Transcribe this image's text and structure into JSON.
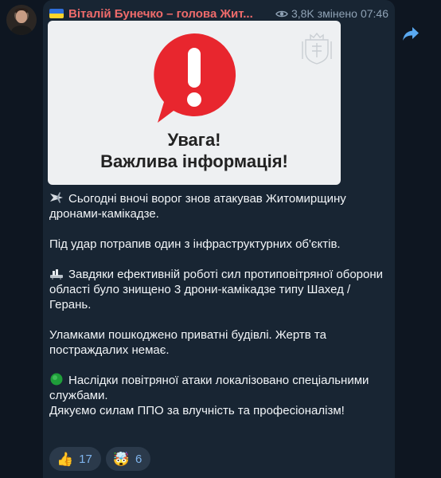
{
  "header": {
    "sender_name": "Віталій Бунечко – голова Жит...",
    "views": "3,8K",
    "edited_label": "змінено",
    "time": "07:46"
  },
  "card": {
    "title_line1": "Увага!",
    "title_line2": "Важлива інформація!"
  },
  "message": {
    "p1": "Сьогодні вночі ворог знов атакував Житомирщину дронами-камікадзе.",
    "p2": "Під удар потрапив один з інфраструктурних об'єктів.",
    "p3": "Завдяки ефективній роботі сил протиповітряної оборони області було знищено 3 дрони-камікадзе типу Шахед /Герань.",
    "p4": "Уламками пошкоджено приватні будівлі. Жертв та постраждалих немає.",
    "p5": "Наслідки повітряної атаки локалізовано спеціальними службами.",
    "p6": "Дякуємо силам ППО за влучність та професіоналізм!"
  },
  "reactions": [
    {
      "emoji": "👍",
      "count": "17"
    },
    {
      "emoji": "🤯",
      "count": "6"
    }
  ],
  "icons": {
    "eye": "eye-icon",
    "forward": "share-forward-icon",
    "flag": "ukraine-flag-icon"
  },
  "colors": {
    "background": "#0e1621",
    "bubble": "#182533",
    "sender": "#ef6b6b",
    "meta": "#8fa2b5",
    "alert_red": "#e8262e",
    "reaction_text": "#7fb4ec"
  }
}
